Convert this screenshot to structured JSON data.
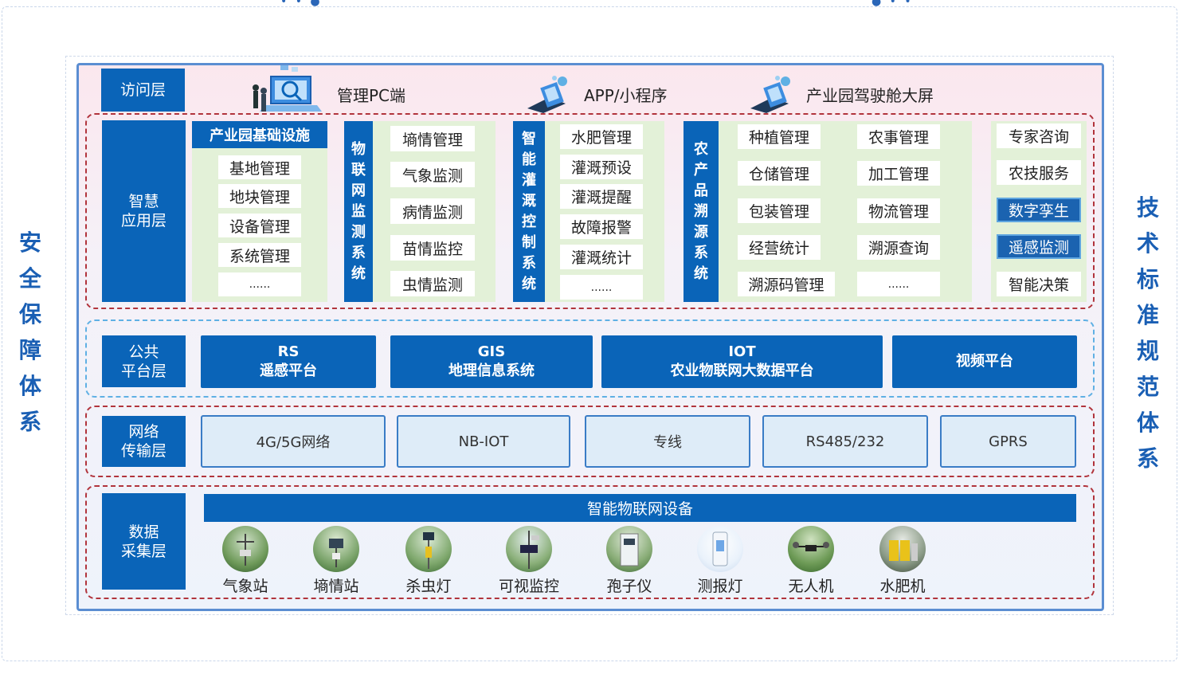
{
  "side": {
    "left": "安全保障体系",
    "right": "技术标准规范体系"
  },
  "access": {
    "layer": "访问层",
    "items": [
      "管理PC端",
      "APP/小程序",
      "产业园驾驶舱大屏"
    ]
  },
  "apps": {
    "layer_line1": "智慧",
    "layer_line2": "应用层",
    "infra": {
      "title": "产业园基础设施",
      "items": [
        "基地管理",
        "地块管理",
        "设备管理",
        "系统管理",
        "......"
      ]
    },
    "iot": {
      "title": "物联网监测系统",
      "items": [
        "墒情管理",
        "气象监测",
        "病情监测",
        "苗情监控",
        "虫情监测"
      ]
    },
    "irrigation": {
      "title": "智能灌溉控制系统",
      "items": [
        "水肥管理",
        "灌溉预设",
        "灌溉提醒",
        "故障报警",
        "灌溉统计",
        "......"
      ]
    },
    "trace": {
      "title": "农产品溯源系统",
      "col1": [
        "种植管理",
        "仓储管理",
        "包装管理",
        "经营统计",
        "溯源码管理"
      ],
      "col2": [
        "农事管理",
        "加工管理",
        "物流管理",
        "溯源查询",
        "......"
      ]
    },
    "expert": {
      "items": [
        "专家咨询",
        "农技服务",
        "数字孪生",
        "遥感监测",
        "智能决策"
      ]
    }
  },
  "platform": {
    "layer_line1": "公共",
    "layer_line2": "平台层",
    "items": [
      {
        "top": "RS",
        "bottom": "遥感平台"
      },
      {
        "top": "GIS",
        "bottom": "地理信息系统"
      },
      {
        "top": "IOT",
        "bottom": "农业物联网大数据平台"
      },
      {
        "top": "",
        "bottom": "视频平台"
      }
    ]
  },
  "network": {
    "layer_line1": "网络",
    "layer_line2": "传输层",
    "items": [
      "4G/5G网络",
      "NB-IOT",
      "专线",
      "RS485/232",
      "GPRS"
    ]
  },
  "data": {
    "layer_line1": "数据",
    "layer_line2": "采集层",
    "banner": "智能物联网设备",
    "devices": [
      "气象站",
      "墒情站",
      "杀虫灯",
      "可视监控",
      "孢子仪",
      "测报灯",
      "无人机",
      "水肥机"
    ]
  },
  "colors": {
    "primary": "#0a64b8",
    "red_dash": "#b1343c",
    "blue_dash": "#5fb0e4",
    "green_panel": "#e3f1d8"
  }
}
